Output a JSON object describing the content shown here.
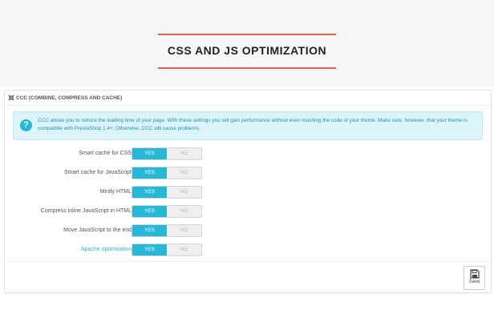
{
  "header": {
    "title": "CSS AND JS OPTIMIZATION"
  },
  "panel": {
    "title": "CCC (COMBINE, COMPRESS AND CACHE)",
    "info": "CCC allows you to reduce the loading time of your page. With these settings you will gain performance without even touching the code of your theme. Make sure, however, that your theme is compatible with PrestaShop 1.4+. Otherwise, CCC will cause problems.",
    "settings": [
      {
        "label": "Smart cache for CSS",
        "yes": "YES",
        "no": "NO",
        "value": "YES"
      },
      {
        "label": "Smart cache for JavaScript",
        "yes": "YES",
        "no": "NO",
        "value": "YES"
      },
      {
        "label": "Minify HTML",
        "yes": "YES",
        "no": "NO",
        "value": "YES"
      },
      {
        "label": "Compress inline JavaScript in HTML",
        "yes": "YES",
        "no": "NO",
        "value": "YES"
      },
      {
        "label": "Move JavaScript to the end",
        "yes": "YES",
        "no": "NO",
        "value": "YES"
      },
      {
        "label": "Apache optimization",
        "yes": "YES",
        "no": "NO",
        "value": "YES"
      }
    ],
    "save_label": "Save"
  },
  "colors": {
    "accent": "#25b9d7",
    "hero_line": "#e8604c"
  },
  "icons": {
    "panel": "compress-icon",
    "info": "question-icon",
    "save": "floppy-disk-icon"
  }
}
